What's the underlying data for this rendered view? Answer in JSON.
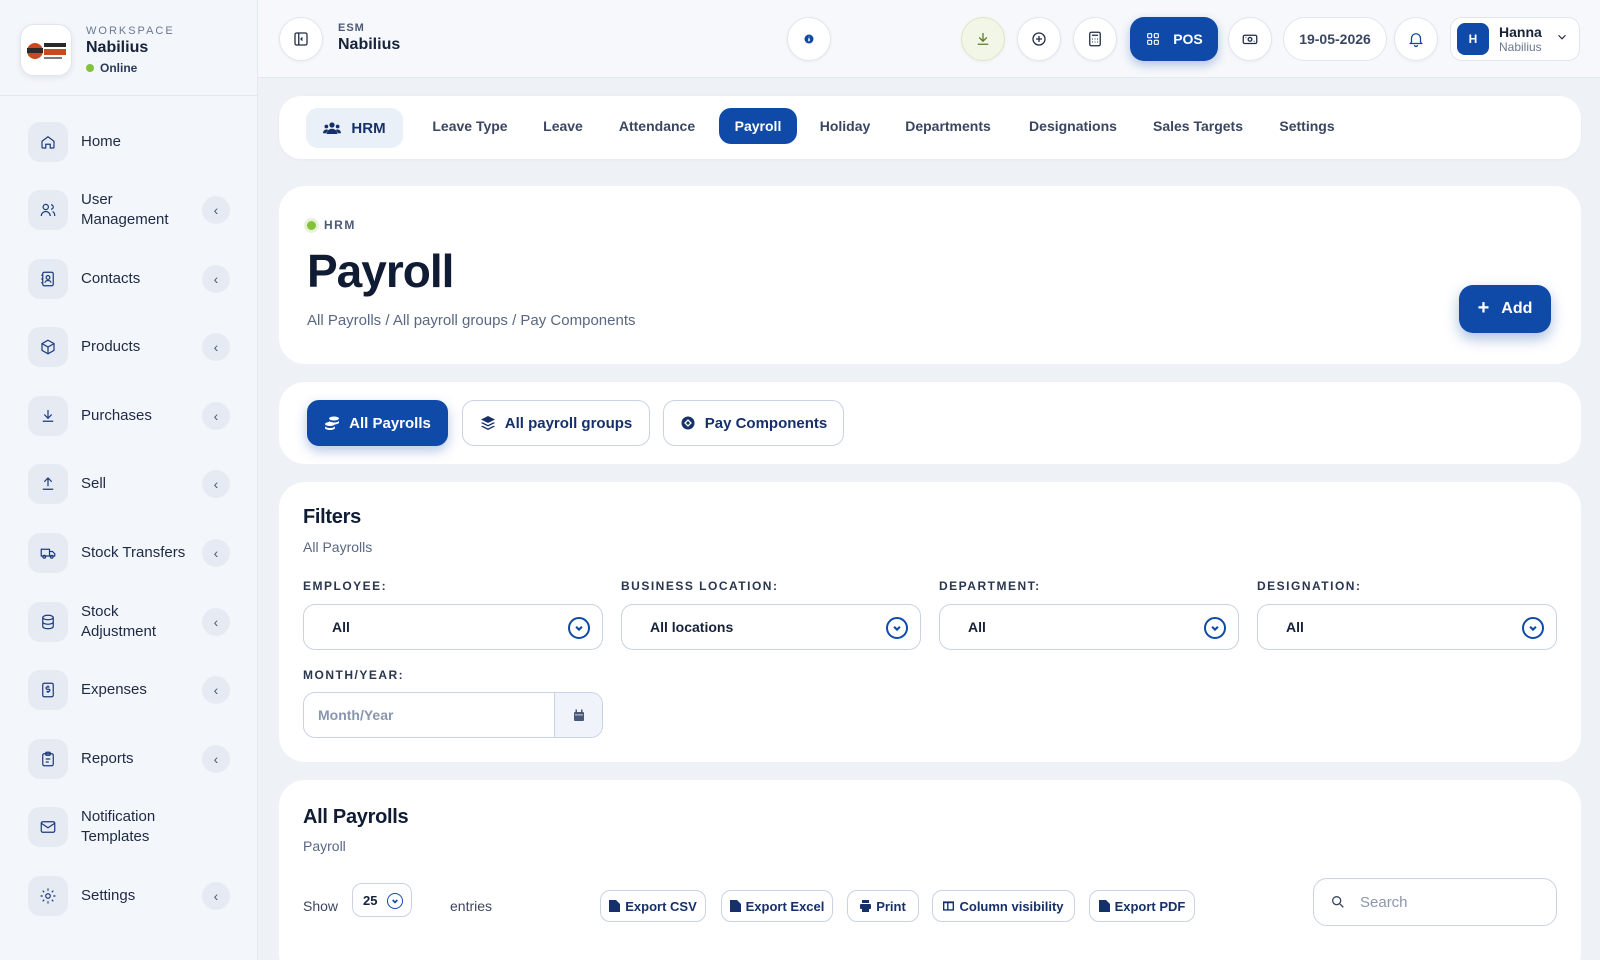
{
  "workspace": {
    "label": "WORKSPACE",
    "name": "Nabilius",
    "status": "Online"
  },
  "sidebar": {
    "items": [
      {
        "label": "Home",
        "icon": "home-icon",
        "has_submenu": false
      },
      {
        "label": "User Management",
        "icon": "users-icon",
        "has_submenu": true
      },
      {
        "label": "Contacts",
        "icon": "contacts-icon",
        "has_submenu": true
      },
      {
        "label": "Products",
        "icon": "box-icon",
        "has_submenu": true
      },
      {
        "label": "Purchases",
        "icon": "download-icon",
        "has_submenu": true
      },
      {
        "label": "Sell",
        "icon": "upload-icon",
        "has_submenu": true
      },
      {
        "label": "Stock Transfers",
        "icon": "truck-icon",
        "has_submenu": true
      },
      {
        "label": "Stock Adjustment",
        "icon": "database-icon",
        "has_submenu": true
      },
      {
        "label": "Expenses",
        "icon": "receipt-icon",
        "has_submenu": true
      },
      {
        "label": "Reports",
        "icon": "clipboard-icon",
        "has_submenu": true
      },
      {
        "label": "Notification Templates",
        "icon": "mail-icon",
        "has_submenu": false
      },
      {
        "label": "Settings",
        "icon": "gear-icon",
        "has_submenu": true
      }
    ]
  },
  "topbar": {
    "small": "ESM",
    "big": "Nabilius",
    "pos_label": "POS",
    "date": "19-05-2026",
    "user": {
      "initial": "H",
      "name": "Hanna",
      "sub": "Nabilius"
    }
  },
  "module": {
    "name": "HRM",
    "tabs": [
      "Leave Type",
      "Leave",
      "Attendance",
      "Payroll",
      "Holiday",
      "Departments",
      "Designations",
      "Sales Targets",
      "Settings"
    ],
    "active": "Payroll"
  },
  "header": {
    "crumb": "HRM",
    "title": "Payroll",
    "links": "All Payrolls / All payroll groups / Pay Components",
    "add_label": "Add"
  },
  "subtabs": [
    {
      "label": "All Payrolls",
      "active": true
    },
    {
      "label": "All payroll groups",
      "active": false
    },
    {
      "label": "Pay Components",
      "active": false
    }
  ],
  "filters": {
    "title": "Filters",
    "subtitle": "All Payrolls",
    "employee": {
      "label": "EMPLOYEE:",
      "value": "All"
    },
    "location": {
      "label": "BUSINESS LOCATION:",
      "value": "All locations"
    },
    "department": {
      "label": "DEPARTMENT:",
      "value": "All"
    },
    "designation": {
      "label": "DESIGNATION:",
      "value": "All"
    },
    "month": {
      "label": "MONTH/YEAR:",
      "placeholder": "Month/Year"
    }
  },
  "table": {
    "title": "All Payrolls",
    "subtitle": "Payroll",
    "show_label": "Show",
    "entries_value": "25",
    "entries_label": "entries",
    "export_buttons": [
      "Export CSV",
      "Export Excel",
      "Print",
      "Column visibility",
      "Export PDF"
    ],
    "search_placeholder": "Search"
  },
  "colors": {
    "primary": "#0f4aa8",
    "online": "#84c23c"
  }
}
